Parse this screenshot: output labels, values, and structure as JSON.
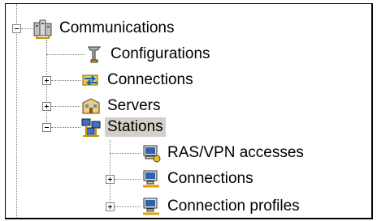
{
  "tree": {
    "root": {
      "label": "Communications",
      "icon": "network-servers-icon",
      "expanded": true
    },
    "children": [
      {
        "label": "Configurations",
        "icon": "configuration-tool-icon",
        "expander": "none"
      },
      {
        "label": "Connections",
        "icon": "connections-arrows-icon",
        "expander": "plus"
      },
      {
        "label": "Servers",
        "icon": "server-building-icon",
        "expander": "plus"
      },
      {
        "label": "Stations",
        "icon": "stations-network-icon",
        "expander": "minus",
        "selected": true,
        "children": [
          {
            "label": "RAS/VPN accesses",
            "icon": "ras-vpn-icon",
            "expander": "none"
          },
          {
            "label": "Connections",
            "icon": "station-connections-icon",
            "expander": "plus"
          },
          {
            "label": "Connection profiles",
            "icon": "connection-profiles-icon",
            "expander": "plus"
          }
        ]
      }
    ]
  },
  "colors": {
    "selection": "#d4d0c8",
    "guide": "#808080"
  }
}
